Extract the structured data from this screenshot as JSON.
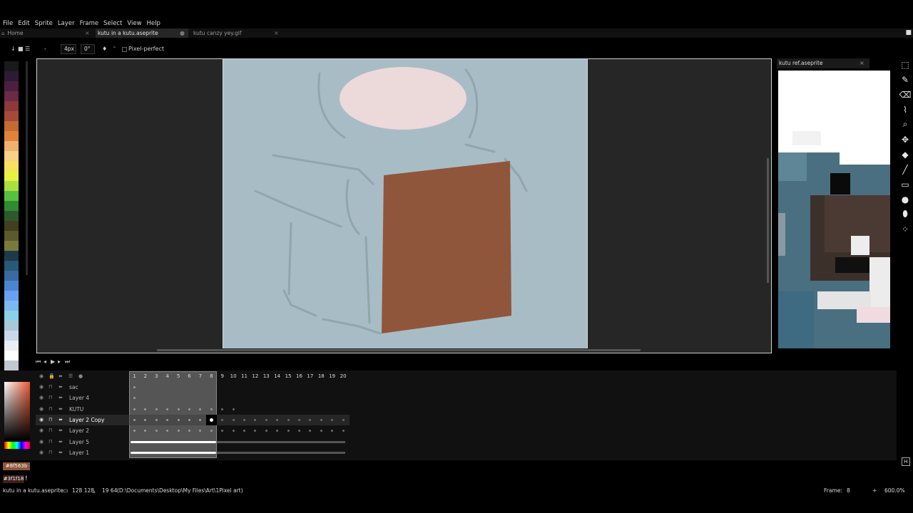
{
  "menu": [
    "File",
    "Edit",
    "Sprite",
    "Layer",
    "Frame",
    "Select",
    "View",
    "Help"
  ],
  "tabs": [
    {
      "label": "Home",
      "active": false
    },
    {
      "label": "kutu in a kutu.aseprite",
      "active": true
    },
    {
      "label": "kutu canzy yey.gif",
      "active": false
    }
  ],
  "toolbar": {
    "brush_size": "4px",
    "brush_angle": "0°",
    "pixel_perfect_label": "Pixel-perfect"
  },
  "palette": [
    "#1a1a1a",
    "#2b1c34",
    "#4b1f3f",
    "#6b2a48",
    "#8a3a3a",
    "#a54a3a",
    "#c46a34",
    "#e0833a",
    "#f0b070",
    "#f7d08a",
    "#f5e060",
    "#e8f040",
    "#a8e040",
    "#58c040",
    "#308a30",
    "#2c5a2c",
    "#404020",
    "#5a5a2a",
    "#7a7a3a",
    "#1d3a4a",
    "#2a5878",
    "#3a6aa0",
    "#4a86d0",
    "#6aa0f0",
    "#7ab8f0",
    "#8ad0e8",
    "#a8c8d8",
    "#c8d8e8",
    "#e8eef4",
    "#ffffff",
    "#c0c8d0",
    "#8090a0"
  ],
  "reference": {
    "title": "kutu ref.aseprite"
  },
  "tools": [
    "marquee-icon",
    "pencil-icon",
    "eraser-icon",
    "eyedropper-icon",
    "zoom-icon",
    "move-icon",
    "bucket-icon",
    "line-icon",
    "rectangle-icon",
    "blur-icon",
    "ink-drop-icon",
    "spray-icon"
  ],
  "timeline": {
    "frame_numbers": [
      "1",
      "2",
      "3",
      "4",
      "5",
      "6",
      "7",
      "8",
      "9",
      "10",
      "11",
      "12",
      "13",
      "14",
      "15",
      "16",
      "17",
      "18",
      "19",
      "20"
    ],
    "layers": [
      {
        "name": "sac",
        "cels": [
          1
        ]
      },
      {
        "name": "Layer 4",
        "cels": [
          1
        ]
      },
      {
        "name": "KUTU",
        "cels": [
          1,
          2,
          3,
          4,
          5,
          6,
          7,
          8,
          9,
          10
        ]
      },
      {
        "name": "Layer 2 Copy",
        "cels": [
          1,
          2,
          3,
          4,
          5,
          6,
          7,
          8,
          9,
          10,
          11,
          12,
          13,
          14,
          15,
          16,
          17,
          18,
          19,
          20
        ]
      },
      {
        "name": "Layer 2",
        "cels": [
          1,
          2,
          3,
          4,
          5,
          6,
          7,
          8,
          9,
          10,
          11,
          12,
          13,
          14,
          15,
          16,
          17,
          18,
          19,
          20
        ]
      },
      {
        "name": "Layer 5",
        "cels": []
      },
      {
        "name": "Layer 1",
        "cels": []
      }
    ]
  },
  "colors": {
    "foreground": "#8f563b",
    "foreground_label": "#8f563b",
    "background_label": "#3f1f18"
  },
  "status": {
    "file": "kutu in a kutu.aseprite",
    "size": "128 128",
    "pos": "19 64",
    "path": "(D:\\Documents\\Desktop\\My Files\\Art\\1Pixel art)",
    "frame_label": "Frame:",
    "frame_value": "8",
    "zoom": "600.0%"
  }
}
